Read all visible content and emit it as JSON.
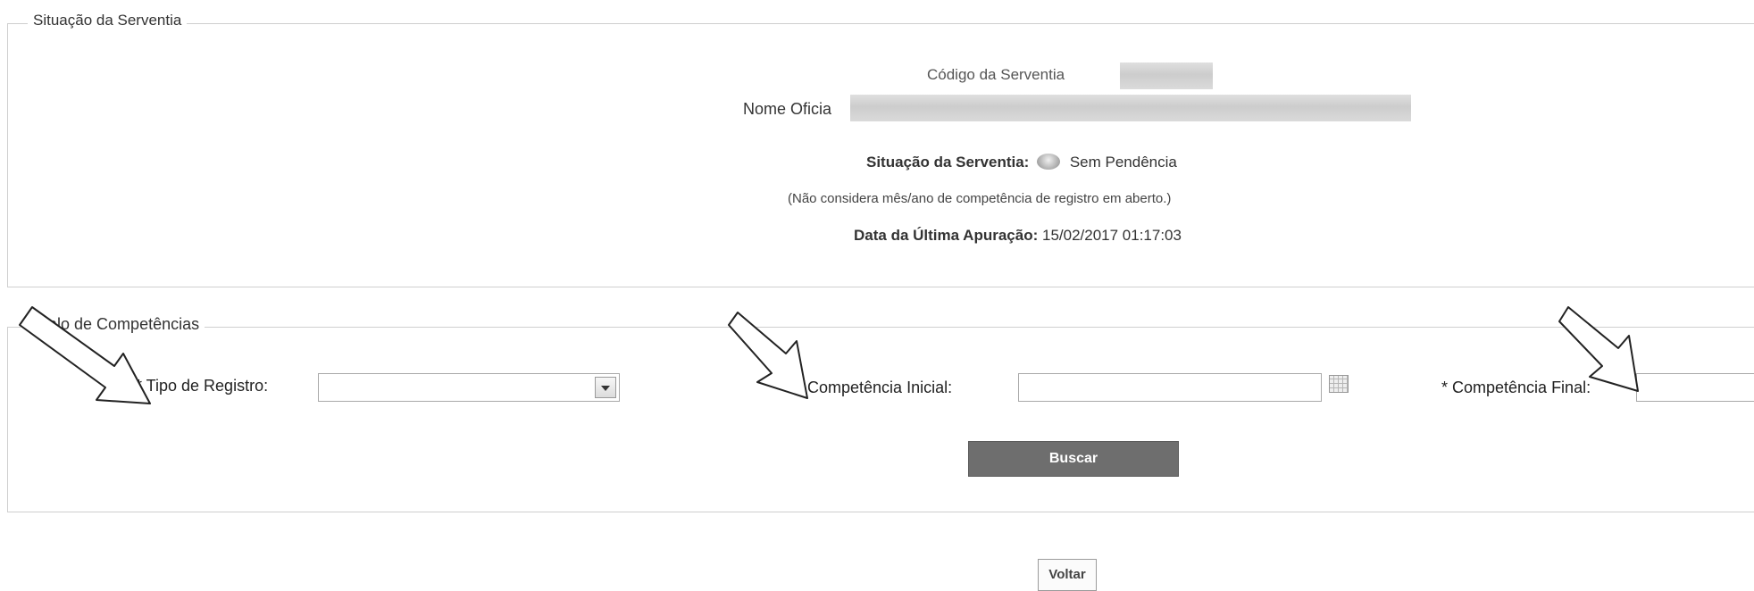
{
  "situacao": {
    "legend": "Situação da Serventia",
    "codigo_label": "Código da Serventia",
    "nome_label": "Nome Oficia",
    "status_label": "Situação da Serventia:",
    "status_icon": "status-icon",
    "status_value": "Sem Pendência",
    "note": "(Não considera mês/ano de competência de registro em aberto.)",
    "apuracao_label": "Data da Última Apuração:",
    "apuracao_value": "15/02/2017 01:17:03"
  },
  "intervalo": {
    "legend": "ervalo de Competências",
    "tipo_label": "* Tipo de Registro:",
    "tipo_value": "",
    "inicial_label": "* Competência Inicial:",
    "inicial_value": "",
    "final_label": "* Competência Final:",
    "final_value": "",
    "buscar_label": "Buscar"
  },
  "voltar_label": "Voltar",
  "colors": {
    "button_gray": "#6e6e6e",
    "border": "#cfcfcf"
  }
}
